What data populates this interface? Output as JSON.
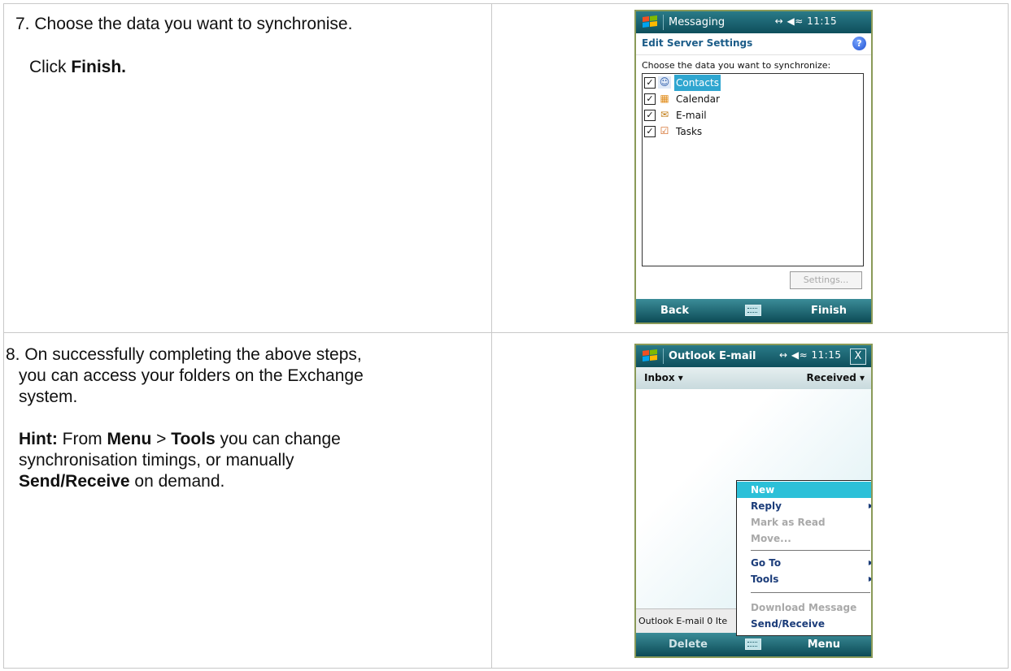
{
  "step7": {
    "line1": "7. Choose the data you want to synchronise.",
    "click_prefix": "Click ",
    "click_bold": "Finish."
  },
  "step8": {
    "line1": "8.  On successfully completing the above steps,",
    "line2": "you can access your folders on the Exchange",
    "line3": "system.",
    "hint_bold": "Hint:",
    "hint_t1": " From ",
    "hint_menu": "Menu",
    "hint_gt": " > ",
    "hint_tools": "Tools",
    "hint_t2": " you can change",
    "hint_line2": "synchronisation timings, or manually",
    "hint_send": "Send/Receive",
    "hint_t3": " on demand."
  },
  "screen1": {
    "title": "Messaging",
    "status": "  ↔ ◀≈ 11:15",
    "header": "Edit Server Settings",
    "help": "?",
    "choose_label": "Choose the data you want to synchronize:",
    "items": [
      {
        "label": "Contacts",
        "checked": "✓",
        "icon": "☺",
        "selected": true
      },
      {
        "label": "Calendar",
        "checked": "✓",
        "icon": "▦",
        "selected": false
      },
      {
        "label": "E-mail",
        "checked": "✓",
        "icon": "✉",
        "selected": false
      },
      {
        "label": "Tasks",
        "checked": "✓",
        "icon": "☑",
        "selected": false
      }
    ],
    "settings_button": "Settings...",
    "softkey_left": "Back",
    "softkey_right": "Finish"
  },
  "screen2": {
    "title": "Outlook E-mail",
    "status": "↔ ◀≈ 11:15",
    "close": "X",
    "folder": "Inbox ▾",
    "sort": "Received ▾",
    "statusline": "Outlook E-mail  0 Ite",
    "menu": {
      "new": "New",
      "reply": "Reply",
      "mark_read": "Mark as Read",
      "move": "Move...",
      "goto": "Go To",
      "tools": "Tools",
      "download": "Download Message",
      "send_receive": "Send/Receive"
    },
    "softkey_left": "Delete",
    "softkey_right": "Menu"
  }
}
